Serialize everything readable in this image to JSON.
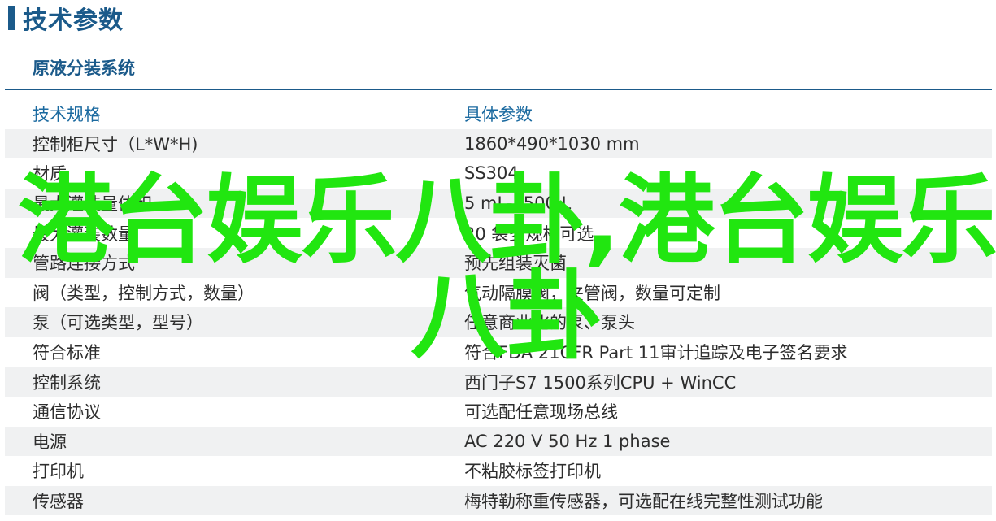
{
  "header": {
    "title": "技术参数"
  },
  "section": {
    "title": "原液分装系统"
  },
  "table": {
    "headers": [
      "技术规格",
      "具体参数"
    ],
    "rows": [
      [
        "控制柜尺寸（L*W*H)",
        "1860*490*1030 mm"
      ],
      [
        "材质",
        "SS304"
      ],
      [
        "最大灌装量体积",
        "5 mL-1500 L"
      ],
      [
        "最大灌装数量",
        "20 袋多规格可选"
      ],
      [
        "管路连接方式",
        "预先组装灭菌"
      ],
      [
        "阀（类型，控制方式，数量）",
        "气动隔膜阀，夹管阀，数量可定制"
      ],
      [
        "泵（可选类型，型号）",
        "任意商业化的泵、泵头"
      ],
      [
        "符合标准",
        "符合FDA 21CFR Part 11审计追踪及电子签名要求"
      ],
      [
        "控制系统",
        "西门子S7 1500系列CPU + WinCC"
      ],
      [
        "通信协议",
        "可选配任意现场总线"
      ],
      [
        "电源",
        "AC 220 V 50 Hz 1 phase"
      ],
      [
        "打印机",
        "不粘胶标签打印机"
      ],
      [
        "传感器",
        "梅特勒称重传感器，可选配在线完整性测试功能"
      ]
    ]
  },
  "watermark": {
    "line1": "港台娱乐八卦,港台娱乐",
    "line2": "八卦",
    "color": "#21e610"
  },
  "colors": {
    "accent": "#1b5a8a",
    "row_shade": "#f0f1f2"
  }
}
